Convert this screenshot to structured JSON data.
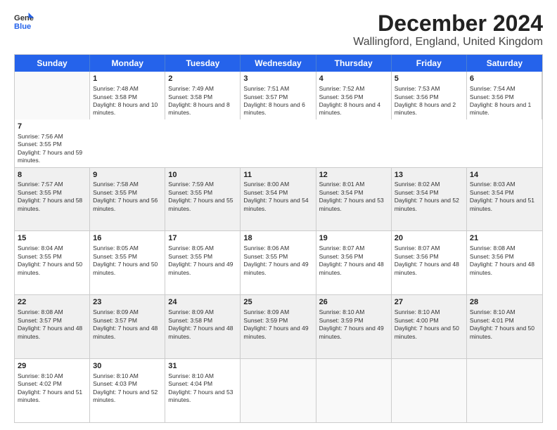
{
  "logo": {
    "line1": "General",
    "line2": "Blue"
  },
  "title": "December 2024",
  "subtitle": "Wallingford, England, United Kingdom",
  "calendar": {
    "headers": [
      "Sunday",
      "Monday",
      "Tuesday",
      "Wednesday",
      "Thursday",
      "Friday",
      "Saturday"
    ],
    "rows": [
      [
        {
          "day": "",
          "empty": true
        },
        {
          "day": "1",
          "sunrise": "Sunrise: 7:48 AM",
          "sunset": "Sunset: 3:58 PM",
          "daylight": "Daylight: 8 hours and 10 minutes."
        },
        {
          "day": "2",
          "sunrise": "Sunrise: 7:49 AM",
          "sunset": "Sunset: 3:58 PM",
          "daylight": "Daylight: 8 hours and 8 minutes."
        },
        {
          "day": "3",
          "sunrise": "Sunrise: 7:51 AM",
          "sunset": "Sunset: 3:57 PM",
          "daylight": "Daylight: 8 hours and 6 minutes."
        },
        {
          "day": "4",
          "sunrise": "Sunrise: 7:52 AM",
          "sunset": "Sunset: 3:56 PM",
          "daylight": "Daylight: 8 hours and 4 minutes."
        },
        {
          "day": "5",
          "sunrise": "Sunrise: 7:53 AM",
          "sunset": "Sunset: 3:56 PM",
          "daylight": "Daylight: 8 hours and 2 minutes."
        },
        {
          "day": "6",
          "sunrise": "Sunrise: 7:54 AM",
          "sunset": "Sunset: 3:56 PM",
          "daylight": "Daylight: 8 hours and 1 minute."
        },
        {
          "day": "7",
          "sunrise": "Sunrise: 7:56 AM",
          "sunset": "Sunset: 3:55 PM",
          "daylight": "Daylight: 7 hours and 59 minutes."
        }
      ],
      [
        {
          "day": "8",
          "sunrise": "Sunrise: 7:57 AM",
          "sunset": "Sunset: 3:55 PM",
          "daylight": "Daylight: 7 hours and 58 minutes."
        },
        {
          "day": "9",
          "sunrise": "Sunrise: 7:58 AM",
          "sunset": "Sunset: 3:55 PM",
          "daylight": "Daylight: 7 hours and 56 minutes."
        },
        {
          "day": "10",
          "sunrise": "Sunrise: 7:59 AM",
          "sunset": "Sunset: 3:55 PM",
          "daylight": "Daylight: 7 hours and 55 minutes."
        },
        {
          "day": "11",
          "sunrise": "Sunrise: 8:00 AM",
          "sunset": "Sunset: 3:54 PM",
          "daylight": "Daylight: 7 hours and 54 minutes."
        },
        {
          "day": "12",
          "sunrise": "Sunrise: 8:01 AM",
          "sunset": "Sunset: 3:54 PM",
          "daylight": "Daylight: 7 hours and 53 minutes."
        },
        {
          "day": "13",
          "sunrise": "Sunrise: 8:02 AM",
          "sunset": "Sunset: 3:54 PM",
          "daylight": "Daylight: 7 hours and 52 minutes."
        },
        {
          "day": "14",
          "sunrise": "Sunrise: 8:03 AM",
          "sunset": "Sunset: 3:54 PM",
          "daylight": "Daylight: 7 hours and 51 minutes."
        }
      ],
      [
        {
          "day": "15",
          "sunrise": "Sunrise: 8:04 AM",
          "sunset": "Sunset: 3:55 PM",
          "daylight": "Daylight: 7 hours and 50 minutes."
        },
        {
          "day": "16",
          "sunrise": "Sunrise: 8:05 AM",
          "sunset": "Sunset: 3:55 PM",
          "daylight": "Daylight: 7 hours and 50 minutes."
        },
        {
          "day": "17",
          "sunrise": "Sunrise: 8:05 AM",
          "sunset": "Sunset: 3:55 PM",
          "daylight": "Daylight: 7 hours and 49 minutes."
        },
        {
          "day": "18",
          "sunrise": "Sunrise: 8:06 AM",
          "sunset": "Sunset: 3:55 PM",
          "daylight": "Daylight: 7 hours and 49 minutes."
        },
        {
          "day": "19",
          "sunrise": "Sunrise: 8:07 AM",
          "sunset": "Sunset: 3:56 PM",
          "daylight": "Daylight: 7 hours and 48 minutes."
        },
        {
          "day": "20",
          "sunrise": "Sunrise: 8:07 AM",
          "sunset": "Sunset: 3:56 PM",
          "daylight": "Daylight: 7 hours and 48 minutes."
        },
        {
          "day": "21",
          "sunrise": "Sunrise: 8:08 AM",
          "sunset": "Sunset: 3:56 PM",
          "daylight": "Daylight: 7 hours and 48 minutes."
        }
      ],
      [
        {
          "day": "22",
          "sunrise": "Sunrise: 8:08 AM",
          "sunset": "Sunset: 3:57 PM",
          "daylight": "Daylight: 7 hours and 48 minutes."
        },
        {
          "day": "23",
          "sunrise": "Sunrise: 8:09 AM",
          "sunset": "Sunset: 3:57 PM",
          "daylight": "Daylight: 7 hours and 48 minutes."
        },
        {
          "day": "24",
          "sunrise": "Sunrise: 8:09 AM",
          "sunset": "Sunset: 3:58 PM",
          "daylight": "Daylight: 7 hours and 48 minutes."
        },
        {
          "day": "25",
          "sunrise": "Sunrise: 8:09 AM",
          "sunset": "Sunset: 3:59 PM",
          "daylight": "Daylight: 7 hours and 49 minutes."
        },
        {
          "day": "26",
          "sunrise": "Sunrise: 8:10 AM",
          "sunset": "Sunset: 3:59 PM",
          "daylight": "Daylight: 7 hours and 49 minutes."
        },
        {
          "day": "27",
          "sunrise": "Sunrise: 8:10 AM",
          "sunset": "Sunset: 4:00 PM",
          "daylight": "Daylight: 7 hours and 50 minutes."
        },
        {
          "day": "28",
          "sunrise": "Sunrise: 8:10 AM",
          "sunset": "Sunset: 4:01 PM",
          "daylight": "Daylight: 7 hours and 50 minutes."
        }
      ],
      [
        {
          "day": "29",
          "sunrise": "Sunrise: 8:10 AM",
          "sunset": "Sunset: 4:02 PM",
          "daylight": "Daylight: 7 hours and 51 minutes."
        },
        {
          "day": "30",
          "sunrise": "Sunrise: 8:10 AM",
          "sunset": "Sunset: 4:03 PM",
          "daylight": "Daylight: 7 hours and 52 minutes."
        },
        {
          "day": "31",
          "sunrise": "Sunrise: 8:10 AM",
          "sunset": "Sunset: 4:04 PM",
          "daylight": "Daylight: 7 hours and 53 minutes."
        },
        {
          "day": "",
          "empty": true
        },
        {
          "day": "",
          "empty": true
        },
        {
          "day": "",
          "empty": true
        },
        {
          "day": "",
          "empty": true
        }
      ]
    ]
  }
}
